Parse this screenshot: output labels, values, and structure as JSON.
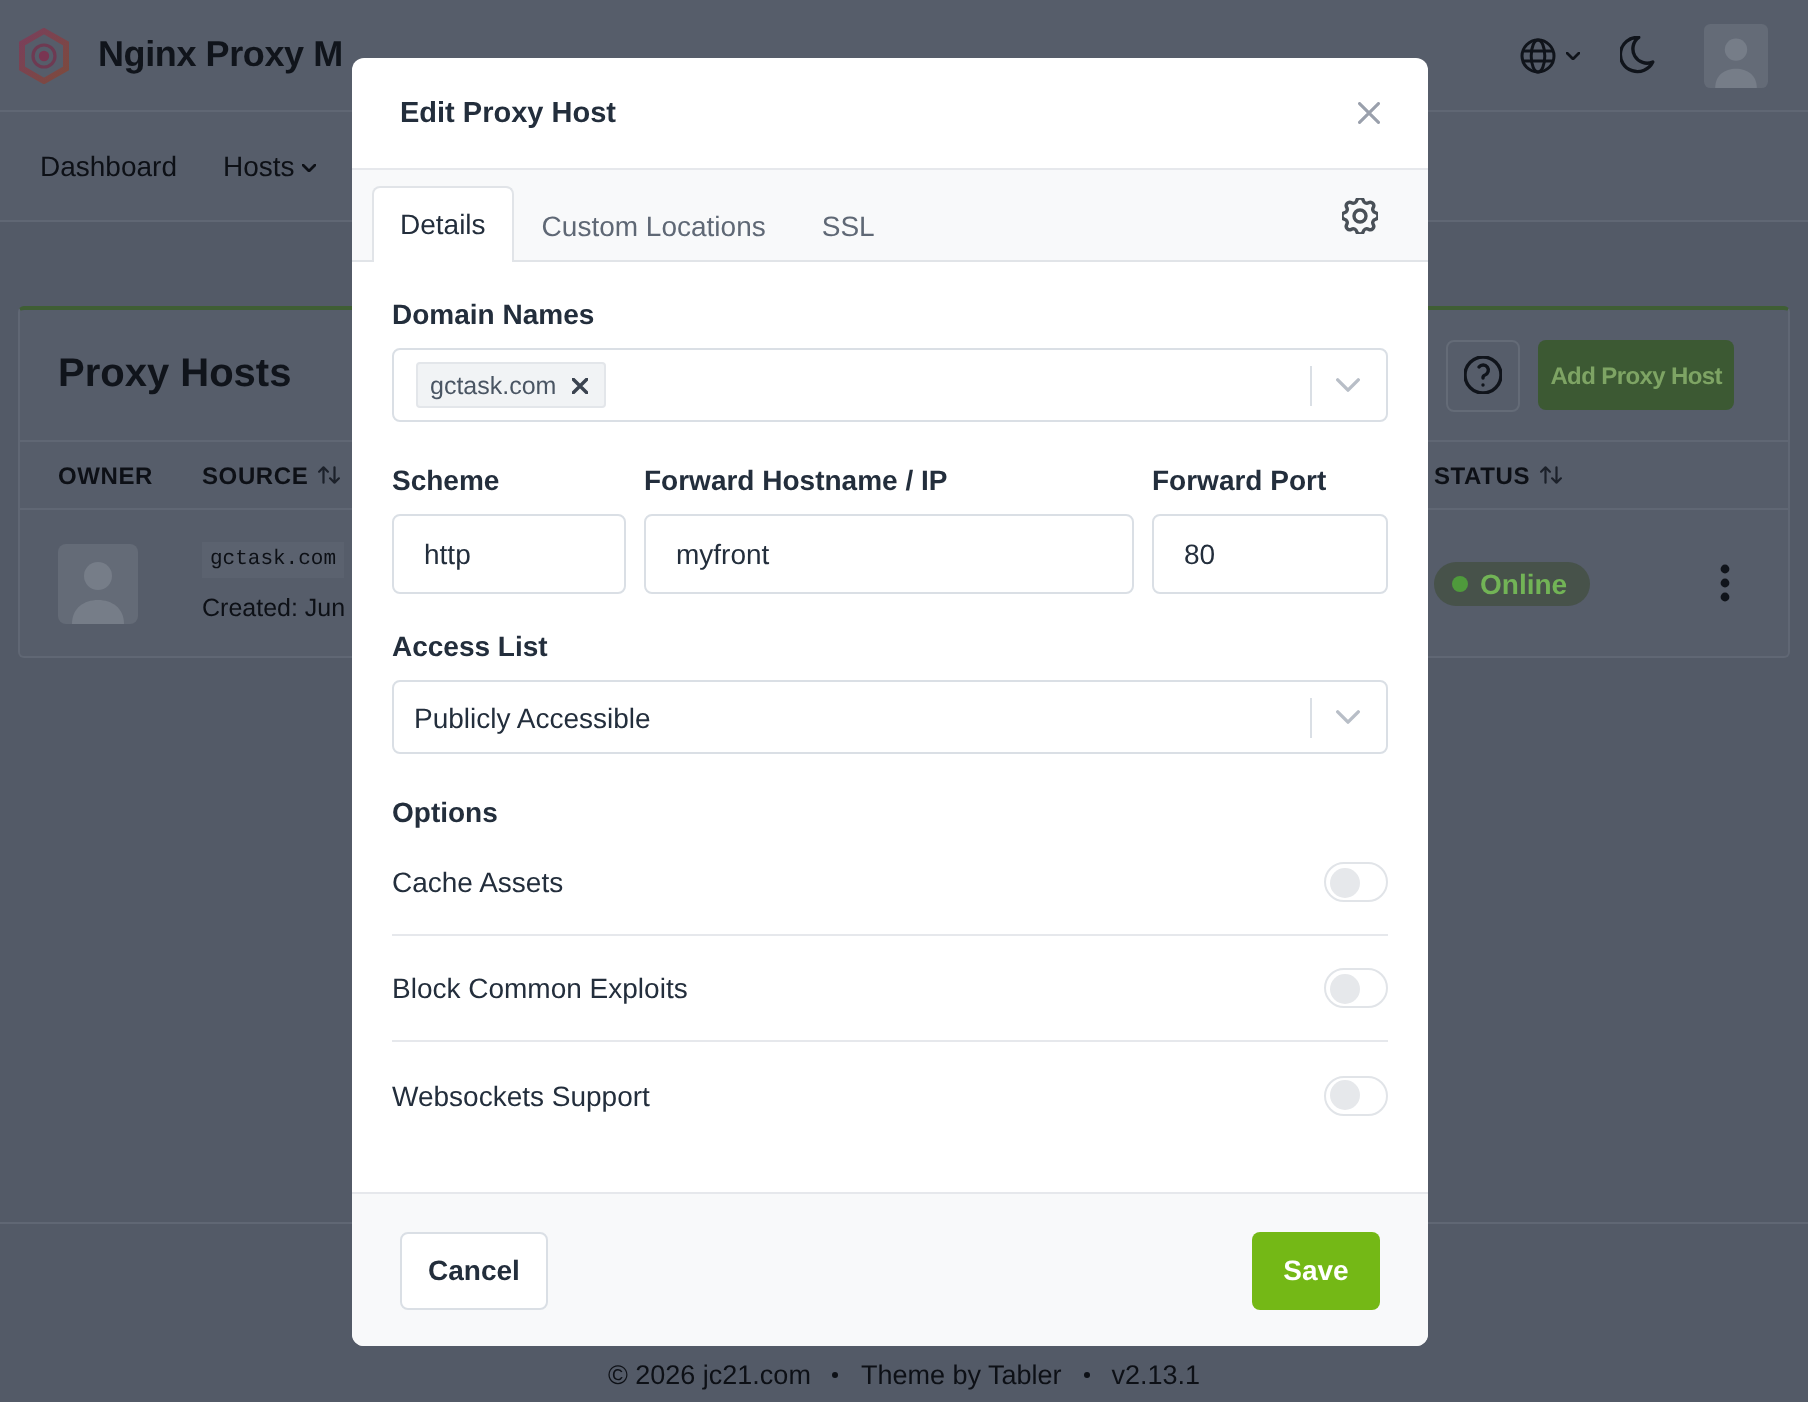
{
  "app_header": {
    "title": "Nginx Proxy M"
  },
  "nav": [
    {
      "label": "Dashboard",
      "menu": false
    },
    {
      "label": "Hosts",
      "menu": true
    }
  ],
  "hosts_card": {
    "title": "Proxy Hosts",
    "add_button": "Add Proxy Host",
    "columns": [
      {
        "label": "OWNER",
        "sortable": false
      },
      {
        "label": "SOURCE",
        "sortable": true
      },
      {
        "label": "STATUS",
        "sortable": true
      }
    ],
    "rows": [
      {
        "source": "gctask.com",
        "created": "Created: Jun",
        "status": "Online"
      }
    ]
  },
  "footer": [
    "© 2026 jc21.com",
    "Theme by Tabler",
    "v2.13.1"
  ],
  "modal": {
    "title": "Edit Proxy Host",
    "tabs": [
      {
        "label": "Details",
        "selected": true
      },
      {
        "label": "Custom Locations",
        "selected": false
      },
      {
        "label": "SSL",
        "selected": false
      }
    ],
    "domain_names": {
      "label": "Domain Names",
      "tags": [
        "gctask.com"
      ]
    },
    "scheme": {
      "label": "Scheme",
      "value": "http"
    },
    "forward_host": {
      "label": "Forward Hostname / IP",
      "value": "myfront"
    },
    "forward_port": {
      "label": "Forward Port",
      "value": "80"
    },
    "access_list": {
      "label": "Access List",
      "value": "Publicly Accessible"
    },
    "options": {
      "label": "Options",
      "items": [
        {
          "label": "Cache Assets",
          "on": false
        },
        {
          "label": "Block Common Exploits",
          "on": false
        },
        {
          "label": "Websockets Support",
          "on": false
        }
      ]
    },
    "buttons": {
      "cancel": "Cancel",
      "save": "Save"
    }
  }
}
